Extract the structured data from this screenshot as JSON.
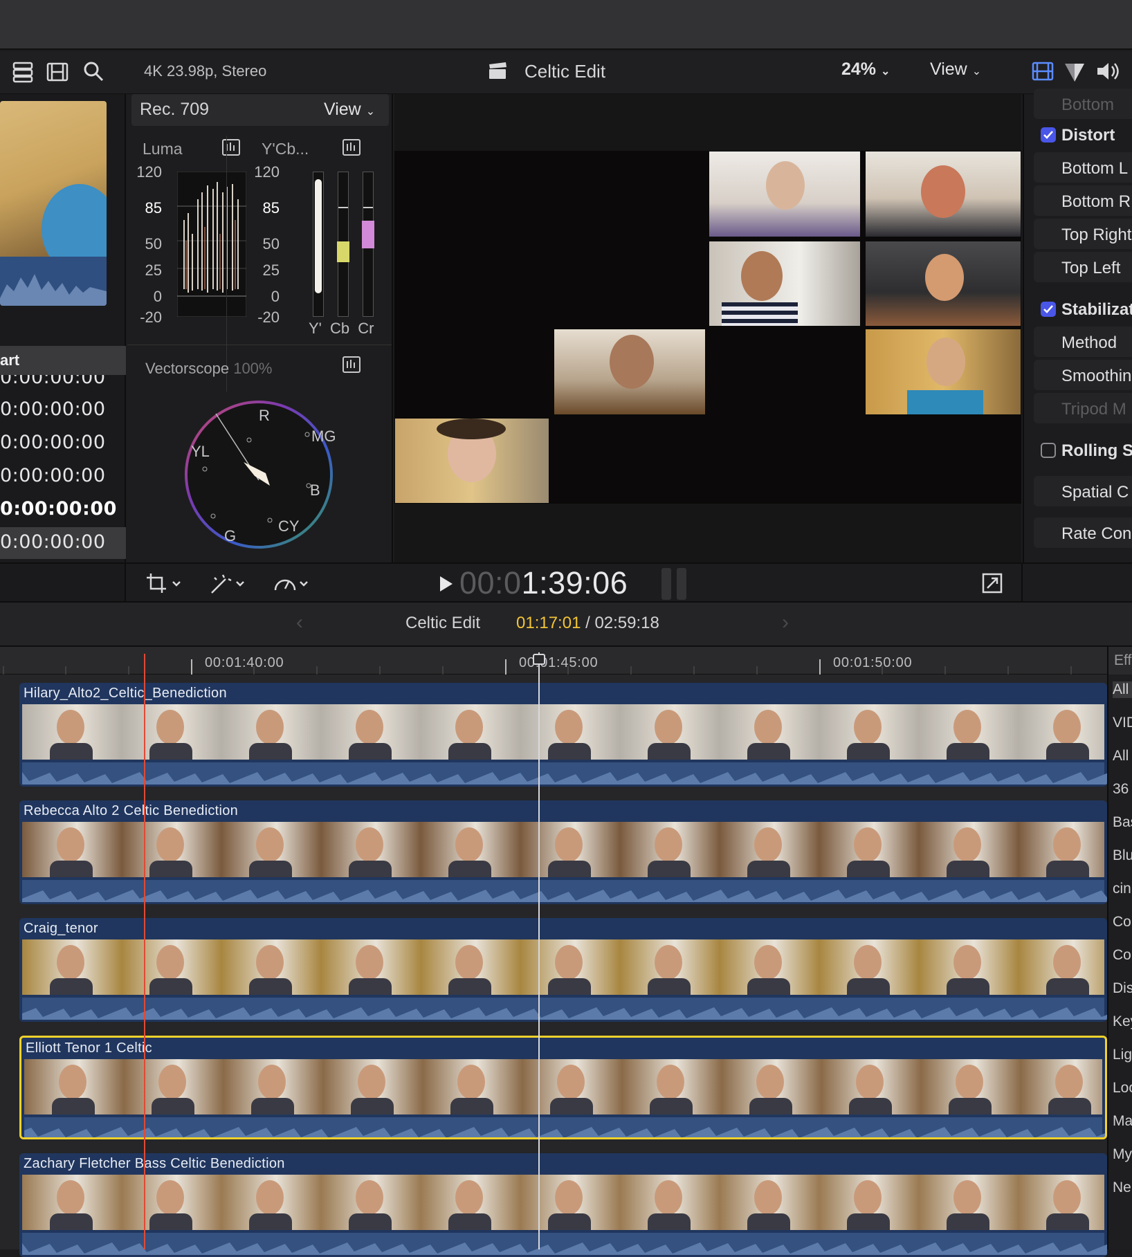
{
  "toolbar": {
    "format": "4K 23.98p, Stereo",
    "project_title": "Celtic Edit",
    "zoom": "24%",
    "view_label": "View",
    "icons": [
      "library-icon",
      "filmstrip-icon",
      "search-icon",
      "clapper-icon",
      "inspector-video-icon",
      "inspector-color-icon",
      "inspector-audio-icon"
    ]
  },
  "browser": {
    "column_header": "art",
    "timecodes": [
      "0:00:00:00",
      "0:00:00:00",
      "0:00:00:00",
      "0:00:00:00",
      "0:00:00:00",
      "0:00:00:00"
    ]
  },
  "scopes": {
    "colorspace": "Rec. 709",
    "view_label": "View",
    "luma_label": "Luma",
    "ycbcr_label": "Y'Cb...",
    "scale": [
      "120",
      "85",
      "50",
      "25",
      "0",
      "-20"
    ],
    "channel_labels": [
      "Y'",
      "Cb",
      "Cr"
    ],
    "vectorscope_label": "Vectorscope",
    "vectorscope_zoom": "100%",
    "vector_targets": [
      "R",
      "MG",
      "YL",
      "B",
      "G",
      "CY"
    ]
  },
  "inspector": {
    "rows": [
      {
        "label": "Bottom",
        "check": "none",
        "dim": true
      },
      {
        "label": "Distort",
        "check": "on"
      },
      {
        "label": "Bottom L",
        "check": "none"
      },
      {
        "label": "Bottom R",
        "check": "none"
      },
      {
        "label": "Top Right",
        "check": "none"
      },
      {
        "label": "Top Left",
        "check": "none"
      },
      {
        "label": "Stabilizat",
        "check": "on"
      },
      {
        "label": "Method",
        "check": "none"
      },
      {
        "label": "Smoothin",
        "check": "none"
      },
      {
        "label": "Tripod M",
        "check": "none",
        "dim": true
      },
      {
        "label": "Rolling S",
        "check": "off"
      },
      {
        "label": "Spatial C",
        "check": "none"
      },
      {
        "label": "Rate Con",
        "check": "none"
      }
    ]
  },
  "viewer_bar": {
    "timecode_dim": "00:0",
    "timecode_bright": "1:39:06",
    "icons": [
      "crop-icon",
      "magic-wand-icon",
      "speed-icon",
      "play-icon",
      "fullscreen-icon"
    ]
  },
  "timeline_header": {
    "project": "Celtic Edit",
    "position": "01:17:01",
    "separator": "/",
    "duration": "02:59:18"
  },
  "ruler": [
    "00:01:40:00",
    "00:01:45:00",
    "00:01:50:00"
  ],
  "clips": [
    {
      "name": "Hilary_Alto2_Celtic_Benediction",
      "selected": false,
      "tone": "#b5b0a8"
    },
    {
      "name": "Rebecca Alto 2 Celtic Benediction",
      "selected": false,
      "tone": "#7a5a3e"
    },
    {
      "name": "Craig_tenor",
      "selected": false,
      "tone": "#a88640"
    },
    {
      "name": "Elliott Tenor 1 Celtic",
      "selected": true,
      "tone": "#8a6a48"
    },
    {
      "name": "Zachary Fletcher Bass Celtic Benediction",
      "selected": false,
      "tone": "#9a7a52"
    }
  ],
  "effects": {
    "header": "Eff",
    "items": [
      "All",
      "VID",
      "All",
      "36",
      "Bas",
      "Blu",
      "cin",
      "Co",
      "Co",
      "Dis",
      "Key",
      "Lig",
      "Loo",
      "Ma",
      "My",
      "Ne"
    ]
  },
  "colors": {
    "accent": "#4a56e8",
    "selection": "#f2d22a",
    "playhead_skim": "#e04a35",
    "clip_blue": "#20365e"
  }
}
